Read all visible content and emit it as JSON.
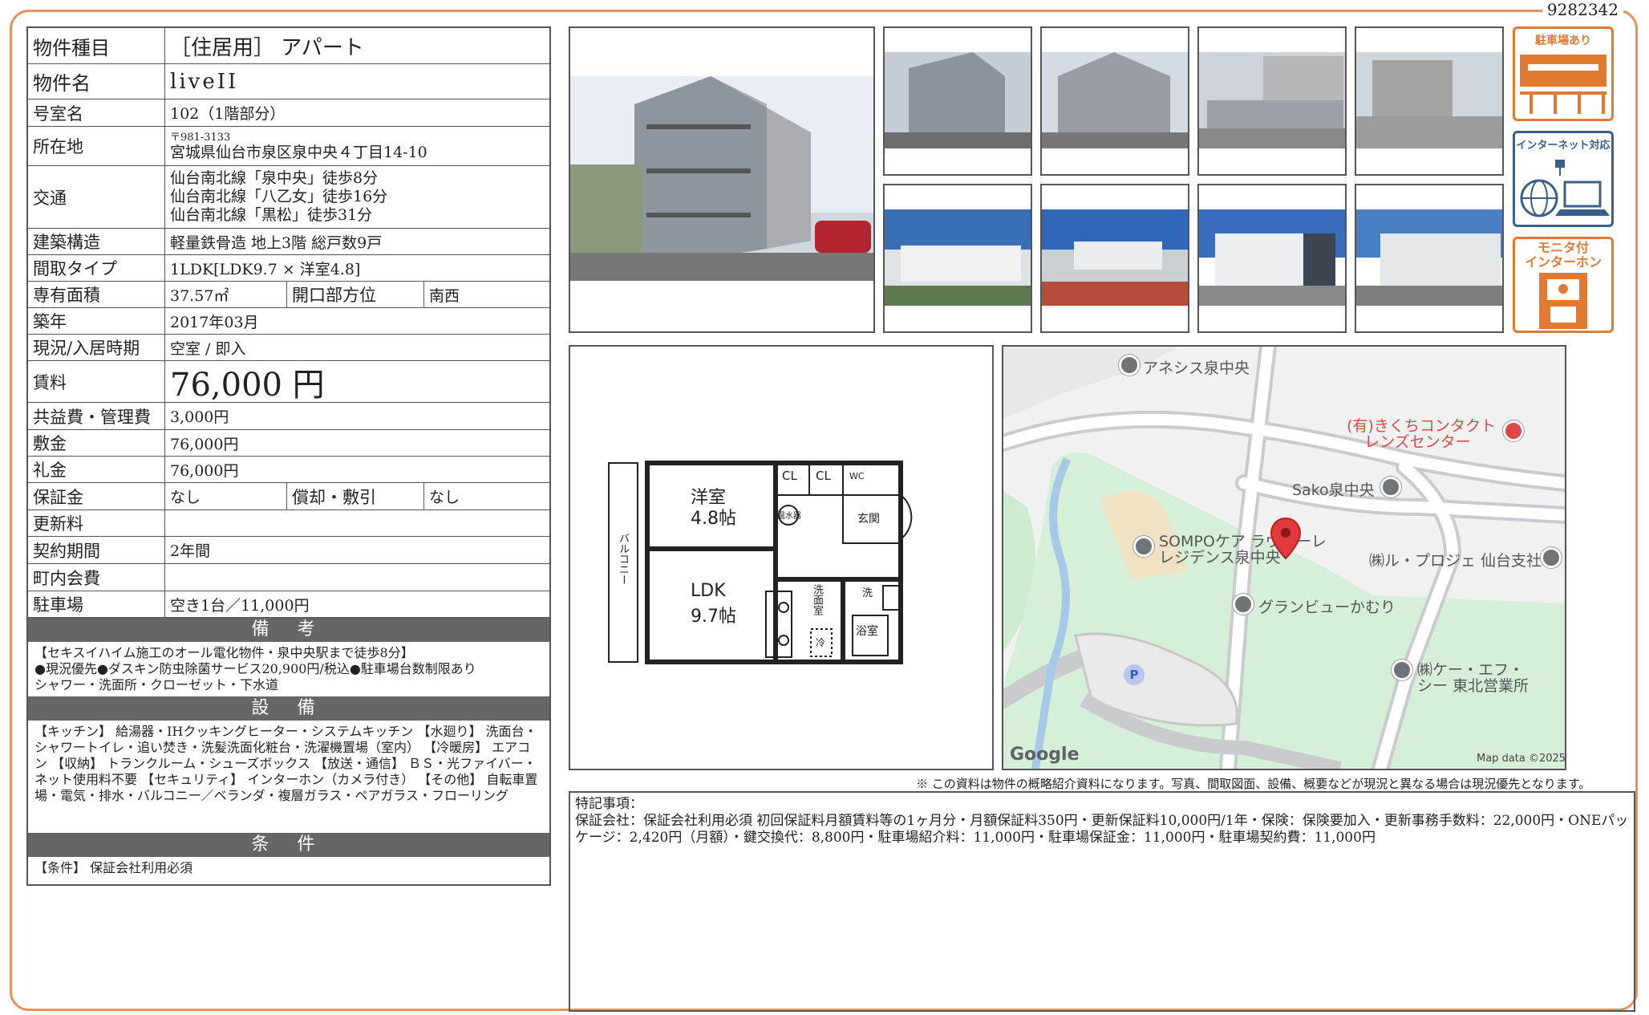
{
  "doc_id": "9282342",
  "spec": {
    "type_label": "物件種目",
    "type_value": "［住居用］ アパート",
    "name_label": "物件名",
    "name_value": "liveII",
    "room_label": "号室名",
    "room_value": "102（1階部分）",
    "addr_label": "所在地",
    "zip": "〒981-3133",
    "addr": "宮城県仙台市泉区泉中央４丁目14-10",
    "access_label": "交通",
    "access": [
      "仙台南北線「泉中央」徒歩8分",
      "仙台南北線「八乙女」徒歩16分",
      "仙台南北線「黒松」徒歩31分"
    ],
    "structure_label": "建築構造",
    "structure_value": "軽量鉄骨造 地上3階 総戸数9戸",
    "layout_label": "間取タイプ",
    "layout_value": "1LDK[LDK9.7 × 洋室4.8]",
    "area_label": "専有面積",
    "area_value": "37.57㎡",
    "facing_label": "開口部方位",
    "facing_value": "南西",
    "built_label": "築年",
    "built_value": "2017年03月",
    "status_label": "現況/入居時期",
    "status_value": "空室 / 即入",
    "rent_label": "賃料",
    "rent_value": "76,000 円",
    "fee_label": "共益費・管理費",
    "fee_value": "3,000円",
    "deposit_label": "敷金",
    "deposit_value": "76,000円",
    "key_label": "礼金",
    "key_value": "76,000円",
    "guarantee_label": "保証金",
    "guarantee_value": "なし",
    "amort_label": "償却・敷引",
    "amort_value": "なし",
    "renewal_label": "更新料",
    "renewal_value": "",
    "term_label": "契約期間",
    "term_value": "2年間",
    "council_label": "町内会費",
    "council_value": "",
    "parking_label": "駐車場",
    "parking_value": "空き1台／11,000円"
  },
  "remarks": {
    "title": "備 考",
    "lines": [
      "【セキスイハイム施工のオール電化物件・泉中央駅まで徒歩8分】",
      "●現況優先●ダスキン防虫除菌サービス20,900円/税込●駐車場台数制限あり",
      "シャワー・洗面所・クローゼット・下水道"
    ]
  },
  "equipment": {
    "title": "設 備",
    "text": "【キッチン】 給湯器・IHクッキングヒーター・システムキッチン 【水廻り】 洗面台・シャワートイレ・追い焚き・洗髪洗面化粧台・洗濯機置場（室内） 【冷暖房】 エアコン 【収納】 トランクルーム・シューズボックス 【放送・通信】 ＢＳ・光ファイバー・ネット使用料不要 【セキュリティ】 インターホン（カメラ付き） 【その他】 自転車置場・電気・排水・バルコニー／ベランダ・複層ガラス・ペアガラス・フローリング"
  },
  "conditions": {
    "title": "条 件",
    "text": "【条件】 保証会社利用必須"
  },
  "badges": {
    "parking": "駐車場あり",
    "internet": "インターネット対応",
    "monitor_1": "モニタ付",
    "monitor_2": "インターホン"
  },
  "floorplan": {
    "room1": "洋室",
    "room1_size": "4.8帖",
    "ldk": "LDK",
    "ldk_size": "9.7帖",
    "cl1": "CL",
    "cl2": "CL",
    "wc": "WC",
    "boiler": "温水器",
    "entrance": "玄関",
    "washroom": "洗面室",
    "washer": "洗",
    "bath": "浴室",
    "fridge": "冷",
    "balcony": "バルコニー"
  },
  "map": {
    "labels": [
      "アネシス泉中央",
      "(有)きくちコンタクト",
      "レンズセンター",
      "Sako泉中央",
      "SOMPOケア ラヴィーレ",
      "レジデンス泉中央",
      "㈱ル・プロジェ 仙台支社",
      "グランビューかむり",
      "㈱ケー・エフ・",
      "シー 東北営業所"
    ],
    "parking_marker": "P",
    "logo": "Google",
    "copyright": "Map data ©2025"
  },
  "disclaimer": "※ この資料は物件の概略紹介資料になります。写真、間取図面、設備、概要などが現況と異なる場合は現況優先となります。",
  "special": {
    "title": "特記事項：",
    "text": "保証会社：保証会社利用必須 初回保証料月額賃料等の1ヶ月分・月額保証料350円・更新保証料10,000円/1年・保険：保険要加入・更新事務手数料：22,000円・ONEパッケージ：2,420円（月額）・鍵交換代：8,800円・駐車場紹介料：11,000円・駐車場保証金：11,000円・駐車場契約費：11,000円"
  }
}
